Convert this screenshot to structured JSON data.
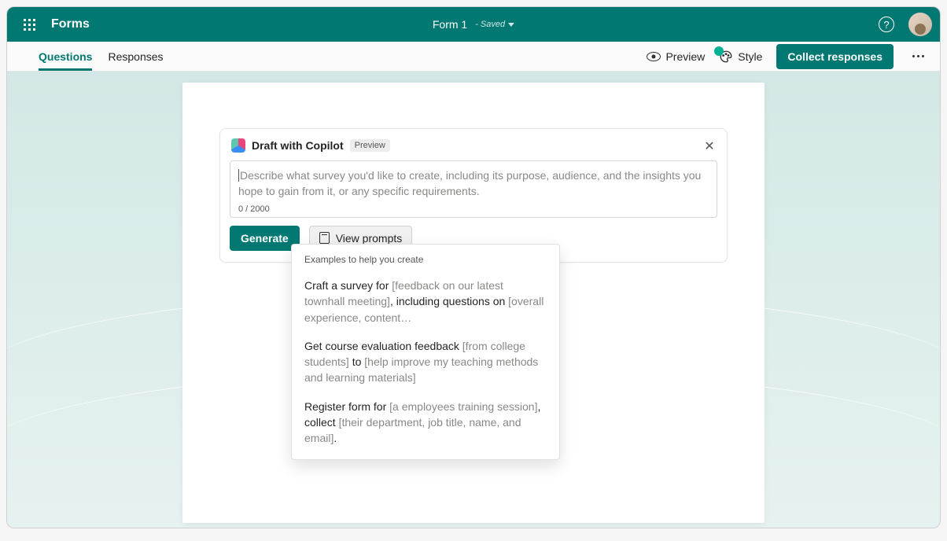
{
  "header": {
    "app_name": "Forms",
    "form_title": "Form 1",
    "saved_label": "- Saved"
  },
  "toolbar": {
    "tabs": {
      "questions": "Questions",
      "responses": "Responses"
    },
    "preview_label": "Preview",
    "style_label": "Style",
    "collect_label": "Collect responses"
  },
  "copilot": {
    "title": "Draft with Copilot",
    "badge": "Preview",
    "placeholder": "Describe what survey you'd like to create, including its purpose, audience, and the insights you hope to gain from it, or any specific requirements.",
    "char_count": "0 / 2000",
    "generate_label": "Generate",
    "view_prompts_label": "View prompts"
  },
  "prompts": {
    "heading": "Examples to help you create",
    "items": [
      {
        "t1": "Craft a survey for ",
        "p1": "[feedback on our latest townhall meeting]",
        "t2": ", including questions on ",
        "p2": "[overall experience, content…"
      },
      {
        "t1": "Get course evaluation feedback ",
        "p1": "[from college students]",
        "t2": " to ",
        "p2": "[help improve my teaching methods and learning materials]"
      },
      {
        "t1": "Register form for ",
        "p1": "[a employees training session]",
        "t2": ", collect ",
        "p2": "[their department, job title, name, and email]",
        "t3": "."
      }
    ]
  }
}
